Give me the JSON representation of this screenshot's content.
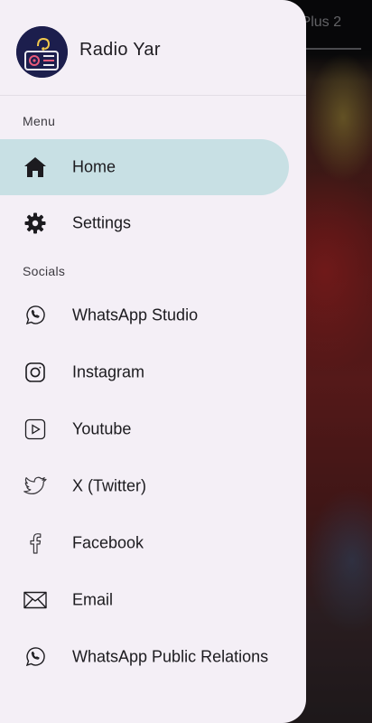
{
  "background": {
    "tab_text": "Plus 2"
  },
  "drawer": {
    "app_name": "Radio Yar",
    "logo_icon": "radio-icon",
    "menu_label": "Menu",
    "menu_items": [
      {
        "label": "Home",
        "icon": "home-icon",
        "active": true
      },
      {
        "label": "Settings",
        "icon": "gear-icon",
        "active": false
      }
    ],
    "socials_label": "Socials",
    "social_items": [
      {
        "label": "WhatsApp Studio",
        "icon": "whatsapp-icon"
      },
      {
        "label": "Instagram",
        "icon": "instagram-icon"
      },
      {
        "label": "Youtube",
        "icon": "youtube-icon"
      },
      {
        "label": "X (Twitter)",
        "icon": "twitter-icon"
      },
      {
        "label": "Facebook",
        "icon": "facebook-icon"
      },
      {
        "label": "Email",
        "icon": "email-icon"
      },
      {
        "label": "WhatsApp Public Relations",
        "icon": "whatsapp-icon"
      }
    ]
  },
  "colors": {
    "drawer_bg": "#f4eff6",
    "active_item_bg": "#c8e0e4",
    "text": "#1c1b1f"
  }
}
